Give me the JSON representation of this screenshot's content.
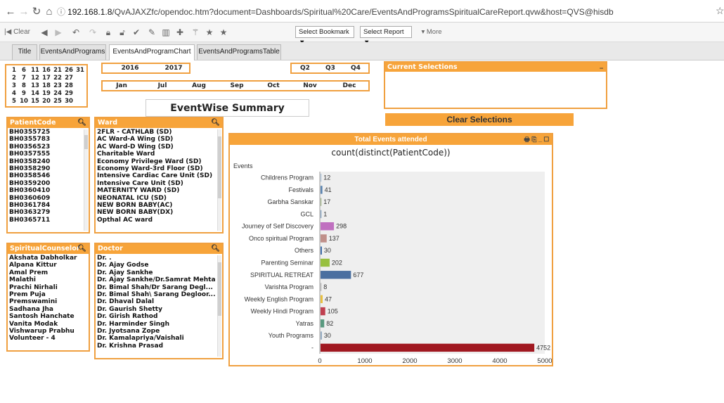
{
  "browser": {
    "url_host": "192.168.1.8",
    "url_path": "/QvAJAXZfc/opendoc.htm?document=Dashboards/Spiritual%20Care/EventsAndProgramsSpiritualCareReport.qvw&host=QVS@hisdb"
  },
  "toolbar": {
    "clear_label": "Clear",
    "bookmark_label": "Select Bookmark ▼",
    "report_label": "Select Report ▼",
    "more_label": "▾ More"
  },
  "tabs": [
    "Title",
    "EventsAndPrograms",
    "EventsAndProgramChart",
    "EventsAndProgramsTable"
  ],
  "day_grid": {
    "rows": [
      [
        "1",
        "6",
        "11",
        "16",
        "21",
        "26",
        "31"
      ],
      [
        "2",
        "7",
        "12",
        "17",
        "22",
        "27"
      ],
      [
        "3",
        "8",
        "13",
        "18",
        "23",
        "28"
      ],
      [
        "4",
        "9",
        "14",
        "19",
        "24",
        "29"
      ],
      [
        "5",
        "10",
        "15",
        "20",
        "25",
        "30"
      ]
    ]
  },
  "years": [
    "2016",
    "2017"
  ],
  "quarters": [
    "Q2",
    "Q3",
    "Q4"
  ],
  "months": [
    "Jan",
    "Jul",
    "Aug",
    "Sep",
    "Oct",
    "Nov",
    "Dec"
  ],
  "current_selections": {
    "title": "Current Selections",
    "minimize": "_"
  },
  "summary_title": "EventWise Summary",
  "clear_selections": "Clear Selections",
  "patient_code": {
    "title": "PatientCode",
    "items": [
      "BH0355725",
      "BH0355783",
      "BH0356523",
      "BH0357555",
      "BH0358240",
      "BH0358290",
      "BH0358546",
      "BH0359200",
      "BH0360410",
      "BH0360609",
      "BH0361784",
      "BH0363279",
      "BH0365711"
    ]
  },
  "ward": {
    "title": "Ward",
    "items": [
      "2FLR - CATHLAB (SD)",
      "AC Ward-A Wing (SD)",
      "AC Ward-D Wing (SD)",
      "Charitable Ward",
      "Economy Privilege Ward (SD)",
      "Economy Ward-3rd Floor (SD)",
      "Intensive Cardiac Care Unit (SD)",
      "Intensive Care Unit (SD)",
      "MATERNITY WARD (SD)",
      "NEONATAL ICU (SD)",
      "NEW BORN BABY(AC)",
      "NEW BORN BABY(DX)",
      "Opthal AC ward"
    ]
  },
  "counselor": {
    "title": "SpiritualCounselor",
    "items": [
      "Akshata Dabholkar",
      "Alpana Kittur",
      "Amal Prem",
      "Malathi",
      "Prachi Nirhali",
      "Prem Puja",
      "Premswamini",
      "Sadhana Jha",
      "Santosh Hanchate",
      "Vanita Modak",
      "Vishwarup Prabhu",
      "Volunteer - 4"
    ]
  },
  "doctor": {
    "title": "Doctor",
    "items": [
      "Dr. .",
      "Dr. Ajay Godse",
      "Dr. Ajay Sankhe",
      "Dr. Ajay Sankhe/Dr.Samrat Mehta",
      "Dr. Bimal Shah/Dr Sarang Degl...",
      "Dr. Bimal Shah\\ Sarang Degloor...",
      "Dr. Dhaval Dalal",
      "Dr. Gaurish Shetty",
      "Dr. Girish Rathod",
      "Dr. Harminder Singh",
      "Dr. Jyotsana Zope",
      "Dr. Kamalapriya/Vaishali",
      "Dr. Krishna Prasad"
    ]
  },
  "chart_data": {
    "type": "bar",
    "title": "Total Events attended",
    "subtitle": "count(distinct(PatientCode))",
    "xlabel": "",
    "ylabel": "Events",
    "orientation": "horizontal",
    "categories": [
      "Childrens Program",
      "Festivals",
      "Garbha Sanskar",
      "GCL",
      "Journey of Self Discovery",
      "Onco spiritual Program",
      "Others",
      "Parenting Seminar",
      "SPIRITUAL RETREAT",
      "Varishta Program",
      "Weekly English Program",
      "Weekly Hindi Program",
      "Yatras",
      "Youth Programs",
      "-"
    ],
    "values": [
      12,
      41,
      17,
      1,
      298,
      137,
      30,
      202,
      677,
      8,
      47,
      105,
      82,
      30,
      4752
    ],
    "colors": [
      "#a8c0d8",
      "#5b84b0",
      "#9ab080",
      "#7799bb",
      "#c070c0",
      "#c0908a",
      "#3a6aa8",
      "#98c040",
      "#4a6fa0",
      "#b0b0b0",
      "#e8c040",
      "#c04050",
      "#5a9a80",
      "#90a8c0",
      "#a01820"
    ],
    "xlim": [
      0,
      5000
    ],
    "xticks": [
      0,
      1000,
      2000,
      3000,
      4000,
      5000
    ],
    "grid": false,
    "legend": "none"
  }
}
